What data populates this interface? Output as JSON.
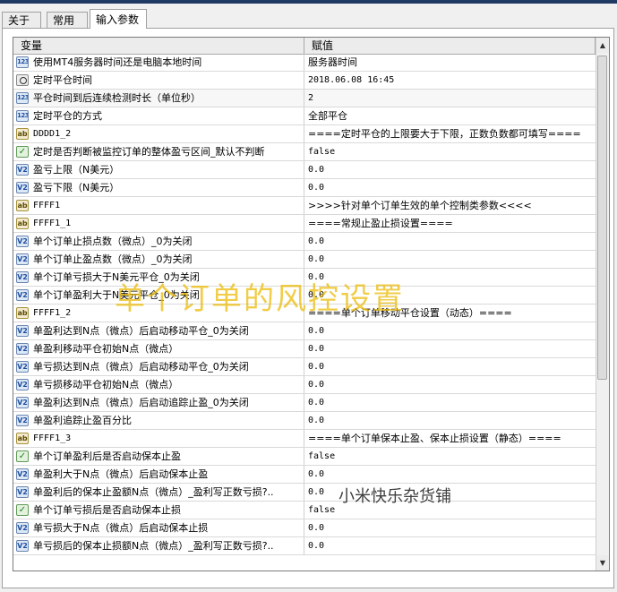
{
  "tabs": [
    {
      "label": "关于",
      "active": false
    },
    {
      "label": "常用",
      "active": false
    },
    {
      "label": "输入参数",
      "active": true
    }
  ],
  "grid": {
    "columns": {
      "name": "变量",
      "value": "赋值"
    },
    "rows": [
      {
        "type": "int",
        "name": "使用MT4服务器时间还是电脑本地时间",
        "value": "服务器时间"
      },
      {
        "type": "datetime",
        "name": "定时平仓时间",
        "value": "2018.06.08 16:45"
      },
      {
        "type": "int",
        "name": "平仓时间到后连续检测时长（单位秒）",
        "value": "2"
      },
      {
        "type": "int",
        "name": "定时平仓的方式",
        "value": "全部平仓"
      },
      {
        "type": "string",
        "name": "DDDD1_2",
        "value": "====定时平仓的上限要大于下限，正数负数都可填写===="
      },
      {
        "type": "bool",
        "name": "定时是否判断被监控订单的整体盈亏区间_默认不判断",
        "value": "false"
      },
      {
        "type": "double",
        "name": "盈亏上限（N美元）",
        "value": "0.0"
      },
      {
        "type": "double",
        "name": "盈亏下限（N美元）",
        "value": "0.0"
      },
      {
        "type": "string",
        "name": "FFFF1",
        "value": ">>>>针对单个订单生效的单个控制类参数<<<<"
      },
      {
        "type": "string",
        "name": "FFFF1_1",
        "value": "====常规止盈止损设置===="
      },
      {
        "type": "double",
        "name": "单个订单止损点数（微点）_0为关闭",
        "value": "0.0"
      },
      {
        "type": "double",
        "name": "单个订单止盈点数（微点）_0为关闭",
        "value": "0.0"
      },
      {
        "type": "double",
        "name": "单个订单亏损大于N美元平仓_0为关闭",
        "value": "0.0"
      },
      {
        "type": "double",
        "name": "单个订单盈利大于N美元平仓_0为关闭",
        "value": "0.0"
      },
      {
        "type": "string",
        "name": "FFFF1_2",
        "value": "====单个订单移动平仓设置（动态）===="
      },
      {
        "type": "double",
        "name": "单盈利达到N点（微点）后启动移动平仓_0为关闭",
        "value": "0.0"
      },
      {
        "type": "double",
        "name": "单盈利移动平仓初始N点（微点）",
        "value": "0.0"
      },
      {
        "type": "double",
        "name": "单亏损达到N点（微点）后启动移动平仓_0为关闭",
        "value": "0.0"
      },
      {
        "type": "double",
        "name": "单亏损移动平仓初始N点（微点）",
        "value": "0.0"
      },
      {
        "type": "double",
        "name": "单盈利达到N点（微点）后启动追踪止盈_0为关闭",
        "value": "0.0"
      },
      {
        "type": "double",
        "name": "单盈利追踪止盈百分比",
        "value": "0.0"
      },
      {
        "type": "string",
        "name": "FFFF1_3",
        "value": "====单个订单保本止盈、保本止损设置（静态）===="
      },
      {
        "type": "bool",
        "name": "单个订单盈利后是否启动保本止盈",
        "value": "false"
      },
      {
        "type": "double",
        "name": "单盈利大于N点（微点）后启动保本止盈",
        "value": "0.0"
      },
      {
        "type": "double",
        "name": "单盈利后的保本止盈额N点（微点）_盈利写正数亏损?..",
        "value": "0.0"
      },
      {
        "type": "bool",
        "name": "单个订单亏损后是否启动保本止损",
        "value": "false"
      },
      {
        "type": "double",
        "name": "单亏损大于N点（微点）后启动保本止损",
        "value": "0.0"
      },
      {
        "type": "double",
        "name": "单亏损后的保本止损额N点（微点）_盈利写正数亏损?..",
        "value": "0.0"
      }
    ]
  },
  "watermarks": {
    "primary": "单个订单的风控设置",
    "secondary": "小米快乐杂货铺"
  },
  "icons": {
    "int": "123",
    "double": "V2",
    "string": "ab",
    "bool": "✓"
  },
  "colors": {
    "accent_bar": "#1f3b63",
    "watermark": "#eab900"
  }
}
